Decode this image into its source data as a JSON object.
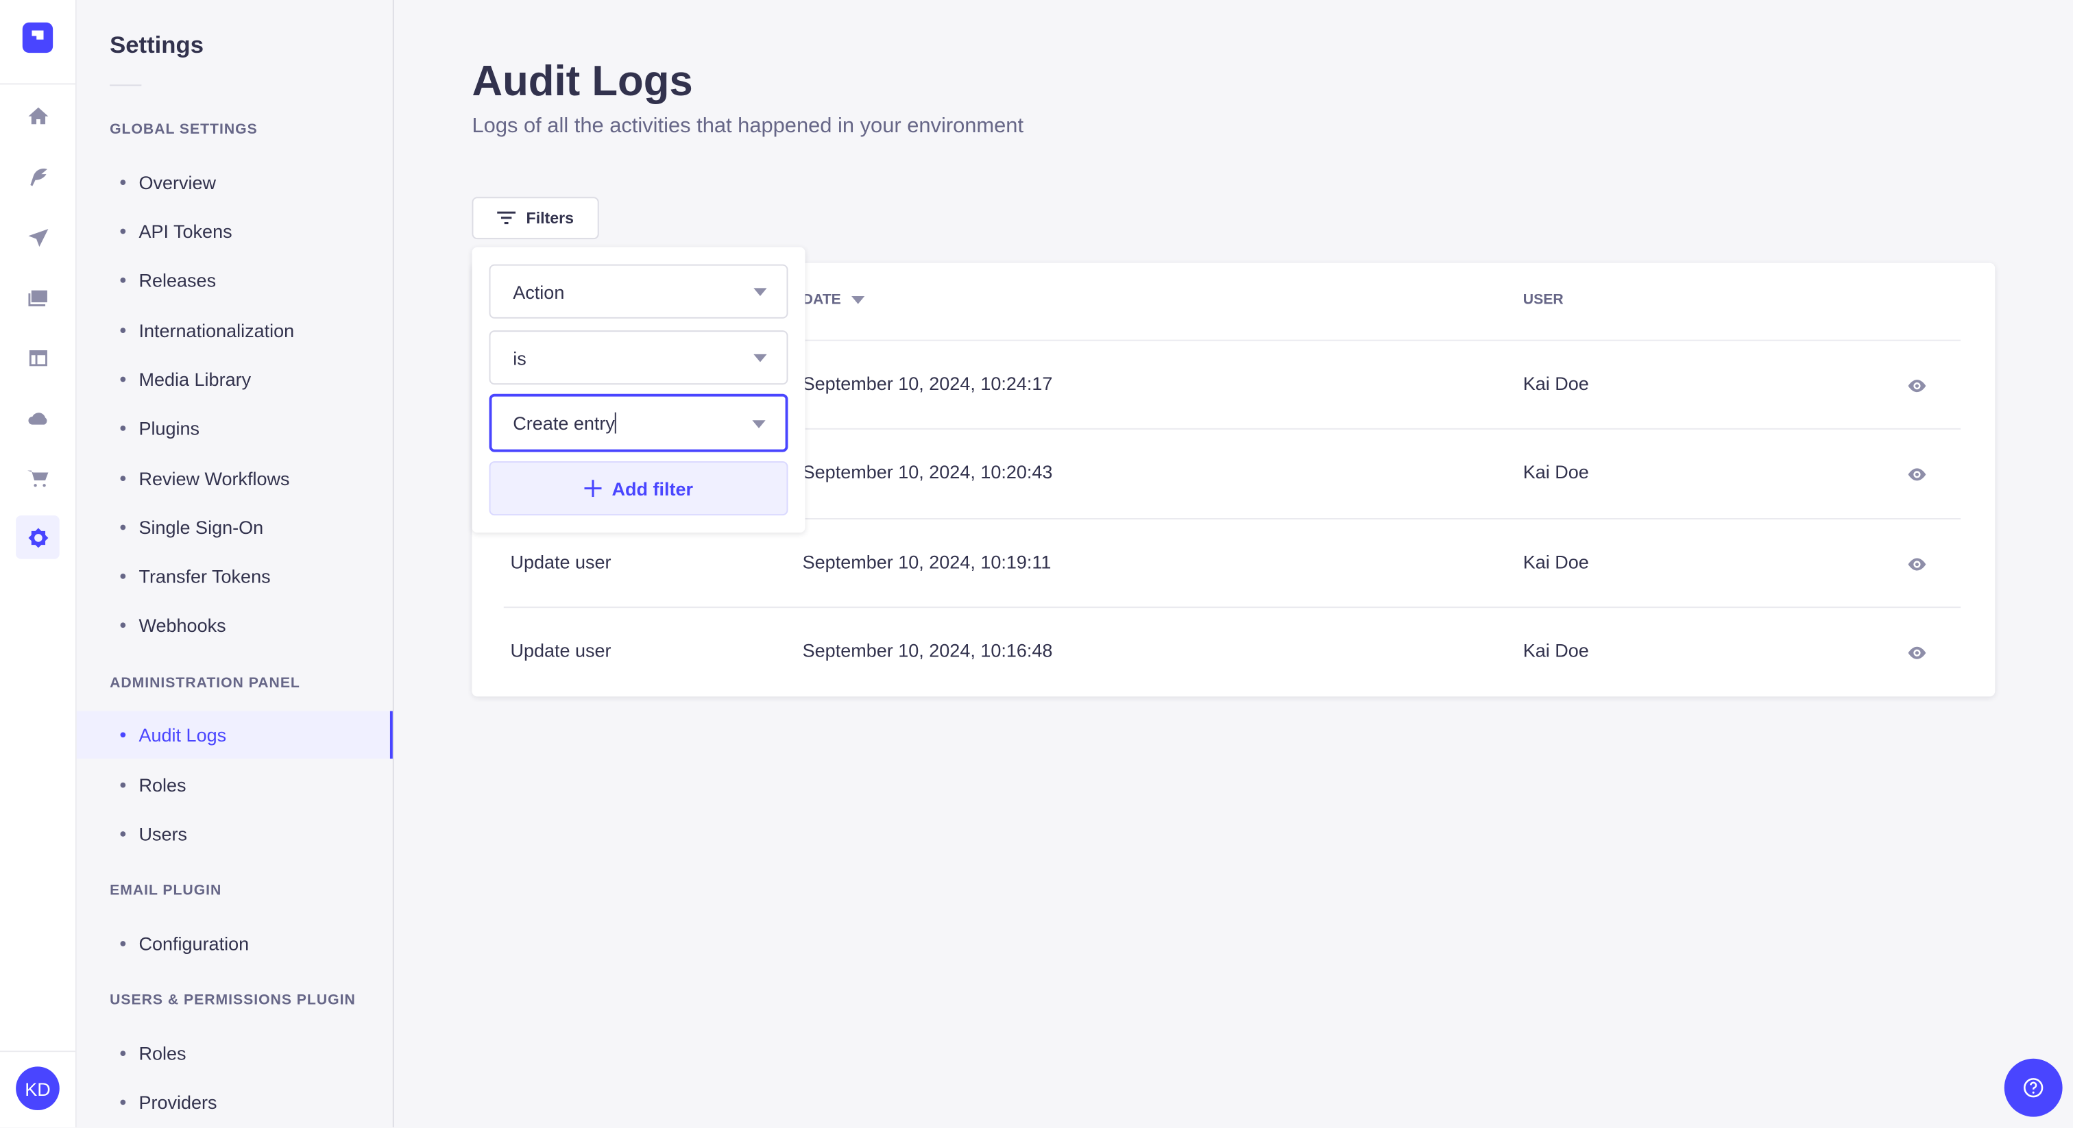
{
  "rail": {
    "icons": [
      "home-icon",
      "feather-icon",
      "paper-plane-icon",
      "images-icon",
      "layout-icon",
      "cloud-icon",
      "cart-icon",
      "cog-icon"
    ],
    "avatar": "KD",
    "accent": "#4945ff"
  },
  "subnav": {
    "title": "Settings",
    "sections": [
      {
        "label": "GLOBAL SETTINGS",
        "items": [
          "Overview",
          "API Tokens",
          "Releases",
          "Internationalization",
          "Media Library",
          "Plugins",
          "Review Workflows",
          "Single Sign-On",
          "Transfer Tokens",
          "Webhooks"
        ]
      },
      {
        "label": "ADMINISTRATION PANEL",
        "items": [
          "Audit Logs",
          "Roles",
          "Users"
        ]
      },
      {
        "label": "EMAIL PLUGIN",
        "items": [
          "Configuration"
        ]
      },
      {
        "label": "USERS & PERMISSIONS PLUGIN",
        "items": [
          "Roles",
          "Providers"
        ]
      }
    ],
    "active": "Audit Logs"
  },
  "page": {
    "title": "Audit Logs",
    "subtitle": "Logs of all the activities that happened in your environment",
    "filters_label": "Filters"
  },
  "filter_popover": {
    "field": "Action",
    "operator": "is",
    "value": "Create entry",
    "add_label": "Add filter"
  },
  "table": {
    "headers": {
      "date": "DATE",
      "user": "USER"
    },
    "rows": [
      {
        "action": "",
        "date": "September 10, 2024, 10:24:17",
        "user": "Kai Doe"
      },
      {
        "action": "",
        "date": "September 10, 2024, 10:20:43",
        "user": "Kai Doe"
      },
      {
        "action": "Update user",
        "date": "September 10, 2024, 10:19:11",
        "user": "Kai Doe"
      },
      {
        "action": "Update user",
        "date": "September 10, 2024, 10:16:48",
        "user": "Kai Doe"
      }
    ]
  }
}
